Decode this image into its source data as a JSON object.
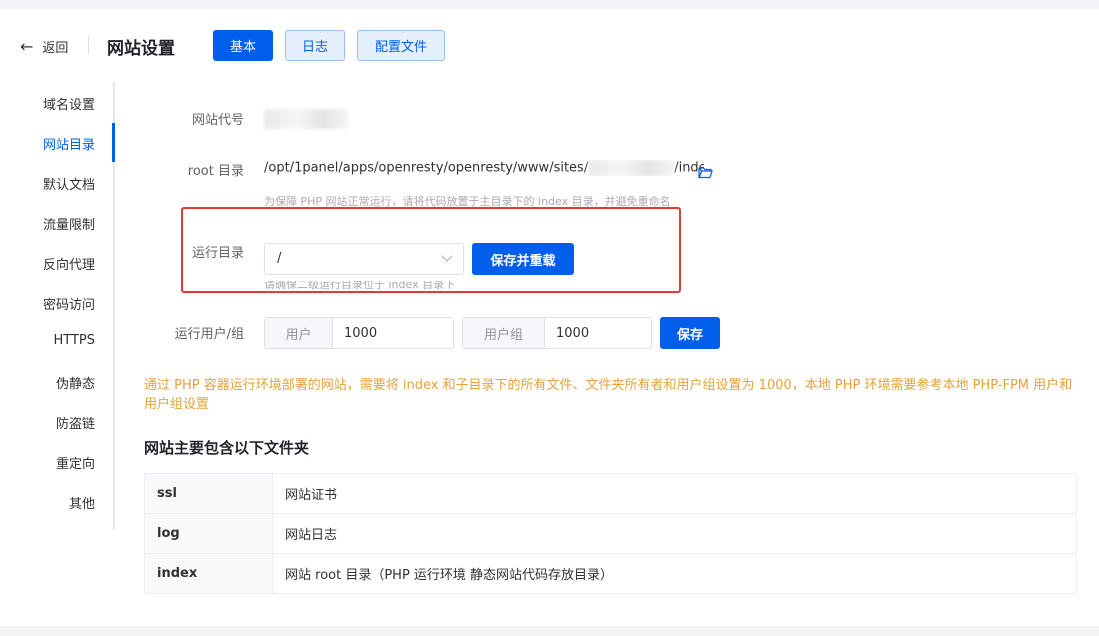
{
  "header": {
    "back_label": "返回",
    "title": "网站设置",
    "tabs": [
      "基本",
      "日志",
      "配置文件"
    ]
  },
  "sidebar": {
    "items": [
      "域名设置",
      "网站目录",
      "默认文档",
      "流量限制",
      "反向代理",
      "密码访问",
      "HTTPS",
      "伪静态",
      "防盗链",
      "重定向",
      "其他"
    ],
    "active": "网站目录"
  },
  "form": {
    "site_code_label": "网站代号",
    "root_label": "root 目录",
    "root_path_prefix": "/opt/1panel/apps/openresty/openresty/www/sites/",
    "root_path_suffix": "/index",
    "root_tip": "为保障 PHP 网站正常运行，请将代码放置于主目录下的 index 目录，并避免重命名",
    "run_dir_label": "运行目录",
    "run_dir_value": "/",
    "save_reload_label": "保存并重载",
    "run_dir_tip": "请确保二级运行目录位于 index 目录下",
    "run_user_label": "运行用户/组",
    "user_prefix": "用户",
    "user_value": "1000",
    "group_prefix": "用户组",
    "group_value": "1000",
    "save_label": "保存"
  },
  "warning_text": "通过 PHP 容器运行环境部署的网站，需要将 index 和子目录下的所有文件、文件夹所有者和用户组设置为 1000，本地 PHP 环境需要参考本地 PHP-FPM 用户和用户组设置",
  "folders": {
    "title": "网站主要包含以下文件夹",
    "rows": [
      {
        "name": "ssl",
        "desc": "网站证书"
      },
      {
        "name": "log",
        "desc": "网站日志"
      },
      {
        "name": "index",
        "desc": "网站 root 目录（PHP 运行环境 静态网站代码存放目录）"
      }
    ]
  },
  "colors": {
    "primary": "#005eeb",
    "warning": "#e6a23c",
    "highlight_box": "#e53935"
  }
}
